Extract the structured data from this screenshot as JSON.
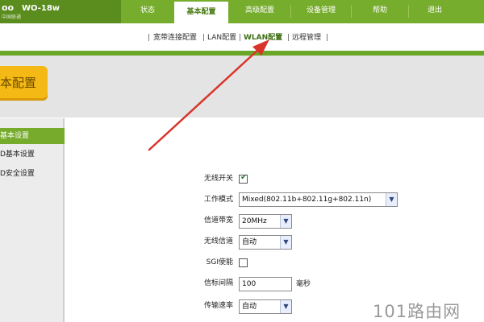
{
  "header": {
    "logo_text": "oo",
    "logo_subtext": "中国联通",
    "model": "WO-18w",
    "nav": [
      {
        "label": "状态"
      },
      {
        "label": "基本配置"
      },
      {
        "label": "高级配置"
      },
      {
        "label": "设备管理"
      },
      {
        "label": "帮助"
      },
      {
        "label": "退出"
      }
    ],
    "active_nav": "基本配置"
  },
  "subnav": {
    "items": [
      {
        "label": "宽带连接配置"
      },
      {
        "label": "LAN配置"
      },
      {
        "label": "WLAN配置"
      },
      {
        "label": "远程管理"
      }
    ],
    "active": "WLAN配置",
    "separator": "|"
  },
  "page_title": "本配置",
  "sidebar": {
    "items": [
      {
        "label": "基本设置"
      },
      {
        "label": "D基本设置"
      },
      {
        "label": "D安全设置"
      }
    ]
  },
  "form": {
    "wireless_switch": {
      "label": "无线开关",
      "checked": true
    },
    "work_mode": {
      "label": "工作模式",
      "value": "Mixed(802.11b+802.11g+802.11n)"
    },
    "channel_bandwidth": {
      "label": "信道带宽",
      "value": "20MHz"
    },
    "wireless_channel": {
      "label": "无线信道",
      "value": "自动"
    },
    "sgi": {
      "label": "SGI使能",
      "checked": false
    },
    "beacon_interval": {
      "label": "信标间隔",
      "value": "100",
      "unit": "毫秒"
    },
    "tx_rate": {
      "label": "传输速率",
      "value": "自动"
    }
  },
  "colors": {
    "header_green": "#77ad2d",
    "accent_green": "#6aa628",
    "title_yellow": "#f4b914",
    "annotation_red": "#d9342b"
  },
  "icons": {
    "checkbox_checked": "check-icon",
    "dropdown": "chevron-down-icon"
  },
  "watermark": "101路由网"
}
